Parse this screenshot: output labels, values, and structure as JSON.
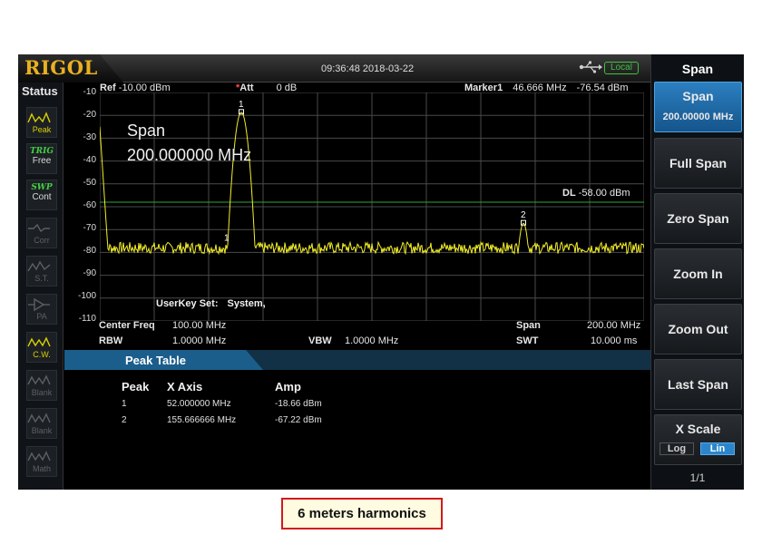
{
  "header": {
    "brand": "RIGOL",
    "datetime": "09:36:48 2018-03-22",
    "remote_status": "Local"
  },
  "status_panel": {
    "title": "Status",
    "items": [
      {
        "id": "peak",
        "label": "Peak",
        "state": "on"
      },
      {
        "id": "trig",
        "label": "TRIG",
        "value": "Free"
      },
      {
        "id": "swp",
        "label": "SWP",
        "value": "Cont"
      },
      {
        "id": "corr",
        "label": "Corr",
        "state": "dim"
      },
      {
        "id": "st",
        "label": "S.T.",
        "state": "dim"
      },
      {
        "id": "pa",
        "label": "PA",
        "state": "dim"
      },
      {
        "id": "cw",
        "label": "C.W.",
        "state": "on"
      },
      {
        "id": "blank1",
        "label": "Blank",
        "state": "dim"
      },
      {
        "id": "blank2",
        "label": "Blank",
        "state": "dim"
      },
      {
        "id": "math",
        "label": "Math",
        "state": "dim"
      }
    ]
  },
  "graph": {
    "ref_label": "Ref",
    "ref_value": "-10.00 dBm",
    "att_label": "Att",
    "att_value": "0 dB",
    "marker_label": "Marker1",
    "marker_freq": "46.666 MHz",
    "marker_amp": "-76.54 dBm",
    "span_title": "Span",
    "span_value": "200.000000 MHz",
    "dl_label": "DL",
    "dl_value": "-58.00 dBm",
    "dl_level_dbm": -58,
    "userkey_label": "UserKey Set:",
    "userkey_value": "System,",
    "y_ticks": [
      "-10",
      "-20",
      "-30",
      "-40",
      "-50",
      "-60",
      "-70",
      "-80",
      "-90",
      "-100",
      "-110"
    ],
    "ylim": [
      -110,
      -10
    ],
    "xlim_mhz": [
      0,
      200
    ],
    "noise_floor_dbm": -78,
    "peaks": [
      {
        "label": "1",
        "freq_mhz": 52.0,
        "amp_dbm": -18.66
      },
      {
        "label": "2",
        "freq_mhz": 155.666666,
        "amp_dbm": -67.22
      }
    ],
    "marker1": {
      "label": "1",
      "freq_mhz": 46.666,
      "amp_dbm": -76.54
    }
  },
  "params": {
    "center_freq_label": "Center Freq",
    "center_freq_value": "100.00 MHz",
    "rbw_label": "RBW",
    "rbw_value": "1.0000 MHz",
    "vbw_label": "VBW",
    "vbw_value": "1.0000 MHz",
    "span_label": "Span",
    "span_value": "200.00 MHz",
    "swt_label": "SWT",
    "swt_value": "10.000 ms"
  },
  "peak_table": {
    "title": "Peak Table",
    "columns": [
      "Peak",
      "X Axis",
      "Amp"
    ],
    "rows": [
      {
        "peak": "1",
        "x": "52.000000 MHz",
        "amp": "-18.66 dBm"
      },
      {
        "peak": "2",
        "x": "155.666666 MHz",
        "amp": "-67.22 dBm"
      }
    ]
  },
  "menu": {
    "title": "Span",
    "buttons": [
      {
        "id": "span",
        "label": "Span",
        "value": "200.00000 MHz",
        "active": true
      },
      {
        "id": "full-span",
        "label": "Full Span"
      },
      {
        "id": "zero-span",
        "label": "Zero Span"
      },
      {
        "id": "zoom-in",
        "label": "Zoom In"
      },
      {
        "id": "zoom-out",
        "label": "Zoom Out"
      },
      {
        "id": "last-span",
        "label": "Last Span"
      },
      {
        "id": "x-scale",
        "label": "X Scale"
      }
    ],
    "x_scale_options": [
      "Log",
      "Lin"
    ],
    "x_scale_selected": "Lin",
    "page_indicator": "1/1"
  },
  "caption": "6 meters harmonics",
  "colors": {
    "trace": "#f2ee2a",
    "display_line": "#2fa82f",
    "grid": "#4a4a4a",
    "accent": "#1b5e8c",
    "logo": "#e9b020"
  }
}
